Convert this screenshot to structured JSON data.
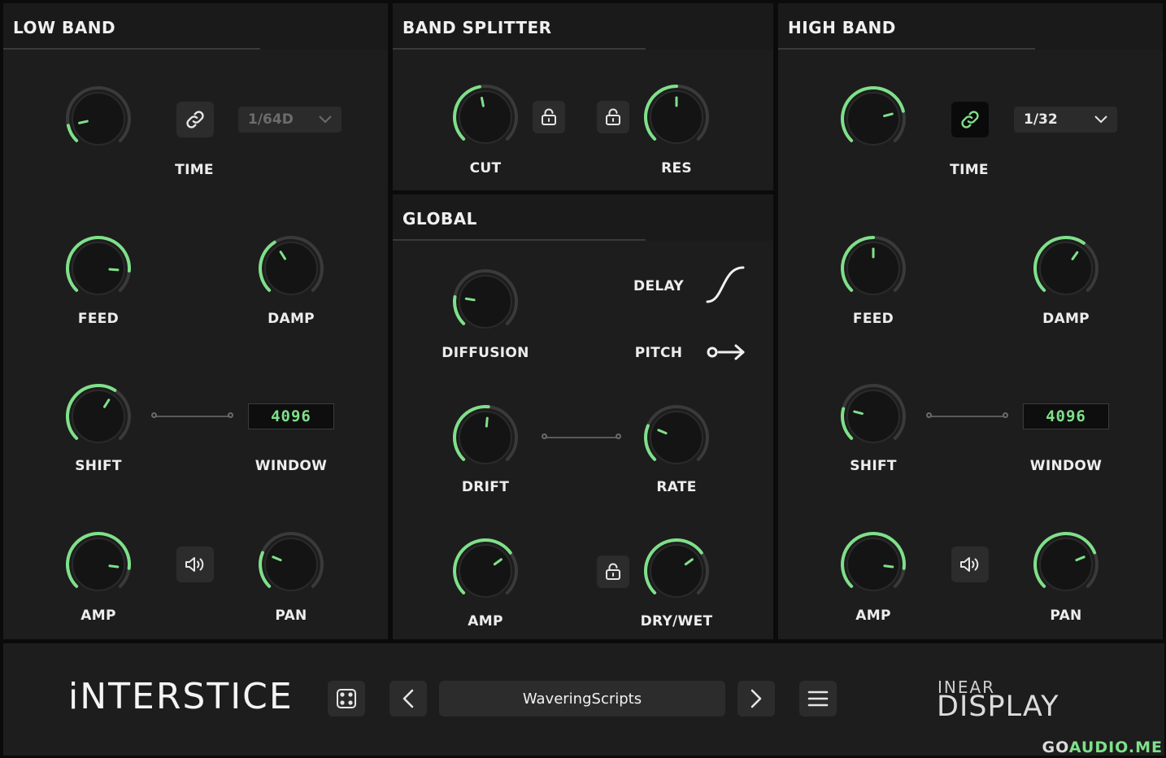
{
  "accent_color": "#7fe08a",
  "panels": {
    "low_band": {
      "title": "LOW BAND",
      "time_label": "TIME",
      "time_division": "1/64D",
      "feed_label": "FEED",
      "damp_label": "DAMP",
      "shift_label": "SHIFT",
      "window_label": "WINDOW",
      "window_value": "4096",
      "amp_label": "AMP",
      "pan_label": "PAN"
    },
    "band_splitter": {
      "title": "BAND SPLITTER",
      "cut_label": "CUT",
      "res_label": "RES"
    },
    "global": {
      "title": "GLOBAL",
      "diffusion_label": "DIFFUSION",
      "delay_label": "DELAY",
      "pitch_label": "PITCH",
      "drift_label": "DRIFT",
      "rate_label": "RATE",
      "amp_label": "AMP",
      "drywet_label": "DRY/WET"
    },
    "high_band": {
      "title": "HIGH BAND",
      "time_label": "TIME",
      "time_division": "1/32",
      "feed_label": "FEED",
      "damp_label": "DAMP",
      "shift_label": "SHIFT",
      "window_label": "WINDOW",
      "window_value": "4096",
      "amp_label": "AMP",
      "pan_label": "PAN"
    }
  },
  "knobs": {
    "low_time": 0.12,
    "low_feed": 0.85,
    "low_damp": 0.38,
    "low_shift": 0.62,
    "low_amp": 0.86,
    "low_pan": 0.25,
    "cut": 0.46,
    "res": 0.5,
    "diffusion": 0.2,
    "drift": 0.52,
    "rate": 0.25,
    "global_amp": 0.7,
    "drywet": 0.7,
    "high_time": 0.78,
    "high_feed": 0.5,
    "high_damp": 0.63,
    "high_shift": 0.22,
    "high_amp": 0.86,
    "high_pan": 0.75
  },
  "footer": {
    "product_name": "iNTERSTICE",
    "preset_name": "WaveringScripts",
    "company_top": "INEAR",
    "company_bottom": "DISPLAY"
  },
  "watermark": {
    "prefix": "GO",
    "main": "AUDIO.ME"
  },
  "icons": [
    "link-icon",
    "chevron-down-icon",
    "lock-icon",
    "speaker-icon",
    "dice-icon",
    "chevron-left-icon",
    "chevron-right-icon",
    "menu-icon",
    "curve-icon",
    "arrow-right-icon"
  ]
}
